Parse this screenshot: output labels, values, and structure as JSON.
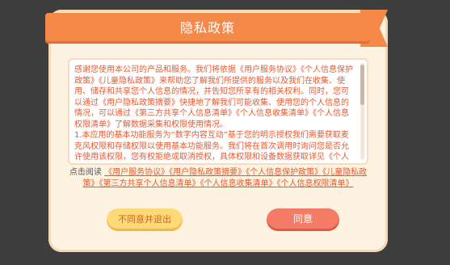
{
  "dialog": {
    "title": "隐私政策",
    "body_text": "感谢您使用本公司的产品和服务。我们将依据《用户服务协议》《个人信息保护政策》《儿童隐私政策》来帮助您了解我们所提供的服务以及我们在收集、使用、储存和共享您个人信息的情况，并告知您所享有的相关权利。同时，您可以通过《用户隐私政策摘要》快捷地了解我们可能收集、使用您的个人信息的情况，可以通过《第三方共享个人信息清单》《个人信息收集清单》《个人信息权限清单》了解数据采集和权限使用情况。\n1.本应用的基本功能服务为“数字内容互动”基于您的明示授权我们需要获取麦克风权限和存储权限以使用基本功能服务。我们将在首次调用时询问您是否允许使用该权限，您有权拒绝或取消授权，具体权限和设备数据获取详见《个人信息权限清单》",
    "read_prefix": "点击阅读",
    "read_links": "《用户服务协议》《用户隐私政策摘要》《个人信息保护政策》《儿童隐私政策》《第三方共享个人信息清单》《个人信息收集清单》《个人信息权限清单》",
    "refuse_button": "不同意并退出",
    "agree_button": "同意"
  },
  "colors": {
    "ribbon": "#f5894a",
    "accent_text": "#e55b32",
    "refuse_bg": "#ffd977",
    "agree_bg": "#f47b65"
  }
}
